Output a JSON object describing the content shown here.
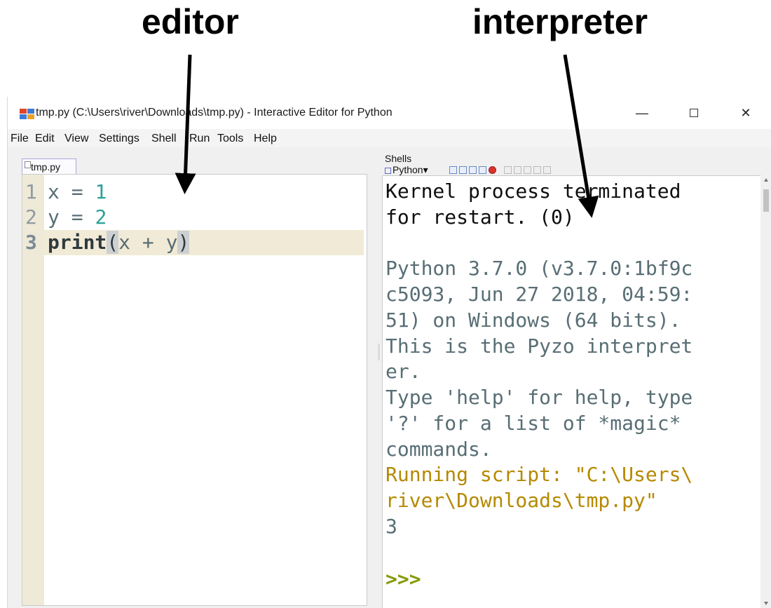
{
  "annotations": {
    "editor_label": "editor",
    "interpreter_label": "interpreter"
  },
  "window": {
    "title": "tmp.py (C:\\Users\\river\\Downloads\\tmp.py) - Interactive Editor for Python",
    "icon": "pyzo-app-icon",
    "controls": {
      "minimize": "—",
      "close": "✕"
    }
  },
  "menubar": {
    "items": [
      "File",
      "Edit",
      "View",
      "Settings",
      "Shell",
      "Run",
      "Tools",
      "Help"
    ]
  },
  "editor": {
    "tab_label": "tmp.py",
    "current_line": 3,
    "lines": [
      {
        "num": "1",
        "tokens": [
          {
            "t": "x",
            "k": "plain"
          },
          {
            "t": " = ",
            "k": "plain"
          },
          {
            "t": "1",
            "k": "num"
          }
        ]
      },
      {
        "num": "2",
        "tokens": [
          {
            "t": "y",
            "k": "plain"
          },
          {
            "t": " = ",
            "k": "plain"
          },
          {
            "t": "2",
            "k": "num"
          }
        ]
      },
      {
        "num": "3",
        "tokens": [
          {
            "t": "print",
            "k": "kw"
          },
          {
            "t": "(",
            "k": "paren"
          },
          {
            "t": "x + y",
            "k": "plain"
          },
          {
            "t": ")",
            "k": "paren"
          }
        ]
      }
    ]
  },
  "shells": {
    "label": "Shells",
    "tab_label": "Python▾",
    "lines": [
      {
        "text": "Kernel process terminated",
        "style": "black"
      },
      {
        "text": "for restart. (0)",
        "style": "black"
      },
      {
        "text": "",
        "style": "grey"
      },
      {
        "text": "Python 3.7.0 (v3.7.0:1bf9c",
        "style": "grey"
      },
      {
        "text": "c5093, Jun 27 2018, 04:59:",
        "style": "grey"
      },
      {
        "text": "51) on Windows (64 bits).",
        "style": "grey"
      },
      {
        "text": "This is the Pyzo interpret",
        "style": "grey"
      },
      {
        "text": "er.",
        "style": "grey"
      },
      {
        "text": "Type 'help' for help, type",
        "style": "grey"
      },
      {
        "text": "'?' for a list of *magic*",
        "style": "grey"
      },
      {
        "text": "commands.",
        "style": "grey"
      },
      {
        "text": "Running script: \"C:\\Users\\",
        "style": "gold"
      },
      {
        "text": "river\\Downloads\\tmp.py\"",
        "style": "gold"
      },
      {
        "text": "3",
        "style": "grey"
      },
      {
        "text": "",
        "style": "grey"
      },
      {
        "text": ">>>",
        "style": "prompt"
      }
    ]
  },
  "colors": {
    "number": "#2aa198",
    "output_grey": "#586e75",
    "script_gold": "#b58900",
    "prompt_green": "#859900",
    "gutter": "#efe9d8"
  }
}
